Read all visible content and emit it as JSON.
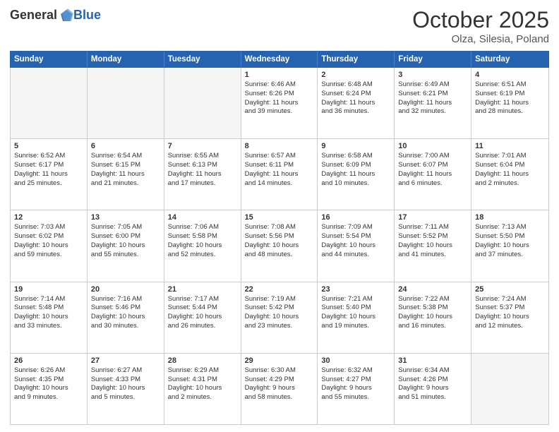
{
  "header": {
    "logo_general": "General",
    "logo_blue": "Blue",
    "month_title": "October 2025",
    "location": "Olza, Silesia, Poland"
  },
  "days_of_week": [
    "Sunday",
    "Monday",
    "Tuesday",
    "Wednesday",
    "Thursday",
    "Friday",
    "Saturday"
  ],
  "rows": [
    {
      "cells": [
        {
          "day": "",
          "content": ""
        },
        {
          "day": "",
          "content": ""
        },
        {
          "day": "",
          "content": ""
        },
        {
          "day": "1",
          "content": "Sunrise: 6:46 AM\nSunset: 6:26 PM\nDaylight: 11 hours\nand 39 minutes."
        },
        {
          "day": "2",
          "content": "Sunrise: 6:48 AM\nSunset: 6:24 PM\nDaylight: 11 hours\nand 36 minutes."
        },
        {
          "day": "3",
          "content": "Sunrise: 6:49 AM\nSunset: 6:21 PM\nDaylight: 11 hours\nand 32 minutes."
        },
        {
          "day": "4",
          "content": "Sunrise: 6:51 AM\nSunset: 6:19 PM\nDaylight: 11 hours\nand 28 minutes."
        }
      ]
    },
    {
      "cells": [
        {
          "day": "5",
          "content": "Sunrise: 6:52 AM\nSunset: 6:17 PM\nDaylight: 11 hours\nand 25 minutes."
        },
        {
          "day": "6",
          "content": "Sunrise: 6:54 AM\nSunset: 6:15 PM\nDaylight: 11 hours\nand 21 minutes."
        },
        {
          "day": "7",
          "content": "Sunrise: 6:55 AM\nSunset: 6:13 PM\nDaylight: 11 hours\nand 17 minutes."
        },
        {
          "day": "8",
          "content": "Sunrise: 6:57 AM\nSunset: 6:11 PM\nDaylight: 11 hours\nand 14 minutes."
        },
        {
          "day": "9",
          "content": "Sunrise: 6:58 AM\nSunset: 6:09 PM\nDaylight: 11 hours\nand 10 minutes."
        },
        {
          "day": "10",
          "content": "Sunrise: 7:00 AM\nSunset: 6:07 PM\nDaylight: 11 hours\nand 6 minutes."
        },
        {
          "day": "11",
          "content": "Sunrise: 7:01 AM\nSunset: 6:04 PM\nDaylight: 11 hours\nand 2 minutes."
        }
      ]
    },
    {
      "cells": [
        {
          "day": "12",
          "content": "Sunrise: 7:03 AM\nSunset: 6:02 PM\nDaylight: 10 hours\nand 59 minutes."
        },
        {
          "day": "13",
          "content": "Sunrise: 7:05 AM\nSunset: 6:00 PM\nDaylight: 10 hours\nand 55 minutes."
        },
        {
          "day": "14",
          "content": "Sunrise: 7:06 AM\nSunset: 5:58 PM\nDaylight: 10 hours\nand 52 minutes."
        },
        {
          "day": "15",
          "content": "Sunrise: 7:08 AM\nSunset: 5:56 PM\nDaylight: 10 hours\nand 48 minutes."
        },
        {
          "day": "16",
          "content": "Sunrise: 7:09 AM\nSunset: 5:54 PM\nDaylight: 10 hours\nand 44 minutes."
        },
        {
          "day": "17",
          "content": "Sunrise: 7:11 AM\nSunset: 5:52 PM\nDaylight: 10 hours\nand 41 minutes."
        },
        {
          "day": "18",
          "content": "Sunrise: 7:13 AM\nSunset: 5:50 PM\nDaylight: 10 hours\nand 37 minutes."
        }
      ]
    },
    {
      "cells": [
        {
          "day": "19",
          "content": "Sunrise: 7:14 AM\nSunset: 5:48 PM\nDaylight: 10 hours\nand 33 minutes."
        },
        {
          "day": "20",
          "content": "Sunrise: 7:16 AM\nSunset: 5:46 PM\nDaylight: 10 hours\nand 30 minutes."
        },
        {
          "day": "21",
          "content": "Sunrise: 7:17 AM\nSunset: 5:44 PM\nDaylight: 10 hours\nand 26 minutes."
        },
        {
          "day": "22",
          "content": "Sunrise: 7:19 AM\nSunset: 5:42 PM\nDaylight: 10 hours\nand 23 minutes."
        },
        {
          "day": "23",
          "content": "Sunrise: 7:21 AM\nSunset: 5:40 PM\nDaylight: 10 hours\nand 19 minutes."
        },
        {
          "day": "24",
          "content": "Sunrise: 7:22 AM\nSunset: 5:38 PM\nDaylight: 10 hours\nand 16 minutes."
        },
        {
          "day": "25",
          "content": "Sunrise: 7:24 AM\nSunset: 5:37 PM\nDaylight: 10 hours\nand 12 minutes."
        }
      ]
    },
    {
      "cells": [
        {
          "day": "26",
          "content": "Sunrise: 6:26 AM\nSunset: 4:35 PM\nDaylight: 10 hours\nand 9 minutes."
        },
        {
          "day": "27",
          "content": "Sunrise: 6:27 AM\nSunset: 4:33 PM\nDaylight: 10 hours\nand 5 minutes."
        },
        {
          "day": "28",
          "content": "Sunrise: 6:29 AM\nSunset: 4:31 PM\nDaylight: 10 hours\nand 2 minutes."
        },
        {
          "day": "29",
          "content": "Sunrise: 6:30 AM\nSunset: 4:29 PM\nDaylight: 9 hours\nand 58 minutes."
        },
        {
          "day": "30",
          "content": "Sunrise: 6:32 AM\nSunset: 4:27 PM\nDaylight: 9 hours\nand 55 minutes."
        },
        {
          "day": "31",
          "content": "Sunrise: 6:34 AM\nSunset: 4:26 PM\nDaylight: 9 hours\nand 51 minutes."
        },
        {
          "day": "",
          "content": ""
        }
      ]
    }
  ]
}
